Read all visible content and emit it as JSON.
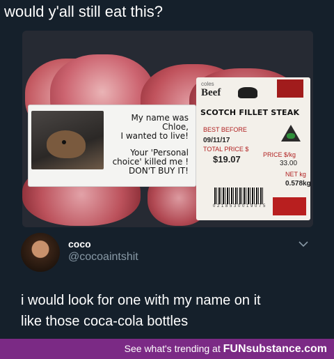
{
  "caption": "would y'all still eat this?",
  "photo": {
    "sticker_lines": [
      "My name was",
      "Chloe,",
      "I wanted to live!"
    ],
    "sticker_lines2": [
      "Your 'Personal",
      "choice' killed me !",
      "DON'T BUY IT!"
    ],
    "label": {
      "brand_small": "coles",
      "brand": "Beef",
      "product": "SCOTCH FILLET STEAK",
      "best_before_label": "BEST BEFORE",
      "best_before": "09/11/17",
      "total_price_label": "TOTAL PRICE $",
      "total_price": "$19.07",
      "price_per_kg_label": "PRICE $/kg",
      "price_per_kg": "33.00",
      "net_kg_label": "NET kg",
      "net_kg": "0.578kg",
      "barcode_number": "0 2 1 8 5 3 0 0 1 9 0 7 5"
    }
  },
  "tweet": {
    "display_name": "coco",
    "handle": "@cocoaintshit",
    "text_line1": "i would look for one with my name on it",
    "text_line2": "like those coca-cola bottles"
  },
  "footer": {
    "text": "See what's trending at ",
    "brand": "FUNsubstance.com"
  },
  "colors": {
    "background": "#15202b",
    "footer": "#7b2a85",
    "handle": "#8899a6"
  }
}
